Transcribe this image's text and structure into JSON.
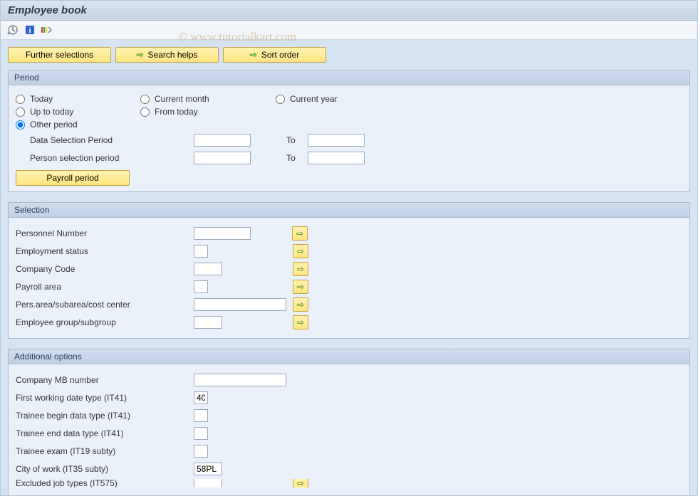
{
  "title": "Employee book",
  "watermark": "© www.tutorialkart.com",
  "buttons": {
    "further": "Further selections",
    "search": "Search helps",
    "sort": "Sort order"
  },
  "period": {
    "legend": "Period",
    "today": "Today",
    "current_month": "Current month",
    "current_year": "Current year",
    "up_to_today": "Up to today",
    "from_today": "From today",
    "other_period": "Other period",
    "data_sel": "Data Selection Period",
    "person_sel": "Person selection period",
    "to": "To",
    "payroll": "Payroll period"
  },
  "selection": {
    "legend": "Selection",
    "pernr": "Personnel Number",
    "empstat": "Employment status",
    "cocode": "Company Code",
    "payarea": "Payroll area",
    "persarea": "Pers.area/subarea/cost center",
    "empgroup": "Employee group/subgroup"
  },
  "addl": {
    "legend": "Additional options",
    "mb": "Company MB number",
    "first_work": "First working date type (IT41)",
    "first_work_val": "40",
    "trainee_begin": "Trainee begin data type (IT41)",
    "trainee_end": "Trainee end data type (IT41)",
    "trainee_exam": "Trainee exam (IT19 subty)",
    "city_work": "City of work (IT35 subty)",
    "city_work_val": "58PL",
    "excluded": "Excluded job types (IT575)"
  }
}
